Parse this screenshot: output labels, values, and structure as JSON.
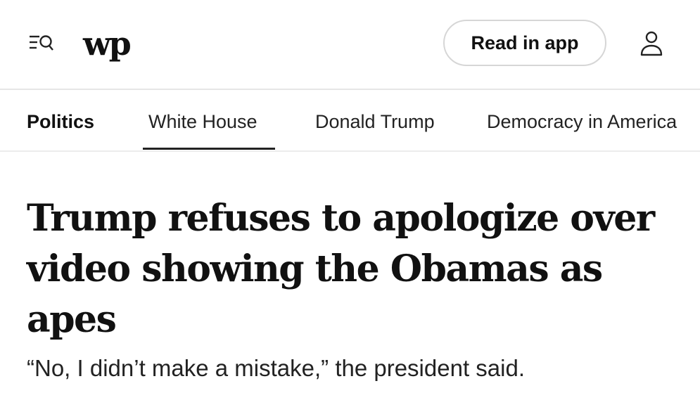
{
  "header": {
    "logo_text": "wp",
    "read_in_app_label": "Read in app",
    "icons": {
      "menu": "menu-search-icon",
      "account": "account-icon"
    }
  },
  "nav": {
    "items": [
      {
        "label": "Politics",
        "kind": "section"
      },
      {
        "label": "White House",
        "kind": "tab",
        "active": true
      },
      {
        "label": "Donald Trump",
        "kind": "tab"
      },
      {
        "label": "Democracy in America",
        "kind": "tab"
      }
    ]
  },
  "article": {
    "headline": "Trump refuses to apologize over video showing the Obamas as apes",
    "subhead": "“No, I didn’t make a mistake,” the president said."
  }
}
